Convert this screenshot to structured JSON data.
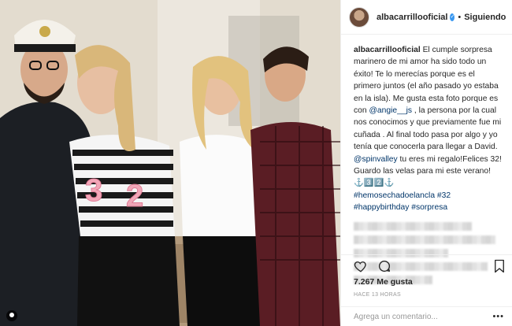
{
  "post": {
    "username": "albacarrillooficial",
    "follow_label": "Siguiendo",
    "separator": "•",
    "caption": {
      "username": "albacarrillooficial",
      "text_1": " El cumple sorpresa marinero de mi amor ha sido todo un éxito! Te lo merecías porque es el primero juntos (el año pasado yo estaba en la isla). Me gusta esta foto porque es con ",
      "mention_1": "@angie__js",
      "text_2": " , la persona por la cual nos conocimos y que previamente fue mi cuñada . Al final todo pasa por algo y yo tenía que conocerla para llegar a David. ",
      "mention_2": "@spinvalley",
      "text_3": " tu eres mi regalo!Felices 32! Guardo las velas para mi este verano! ⚓️3️⃣2️⃣⚓️",
      "hashtags": "#hemosechadoelancla #32 #happybirthday #sorpresa"
    },
    "likes": "7.267 Me gusta",
    "time_ago": "HACE 13 HORAS",
    "comment_placeholder": "Agrega un comentario...",
    "more_options": "•••"
  },
  "icons": {
    "verified": "verified-badge-icon",
    "like": "heart-icon",
    "comment": "comment-bubble-icon",
    "save": "bookmark-icon",
    "photo_user": "user-tag-icon"
  },
  "colors": {
    "link": "#003569",
    "verified": "#3897f0",
    "text": "#262626",
    "muted": "#999999"
  }
}
